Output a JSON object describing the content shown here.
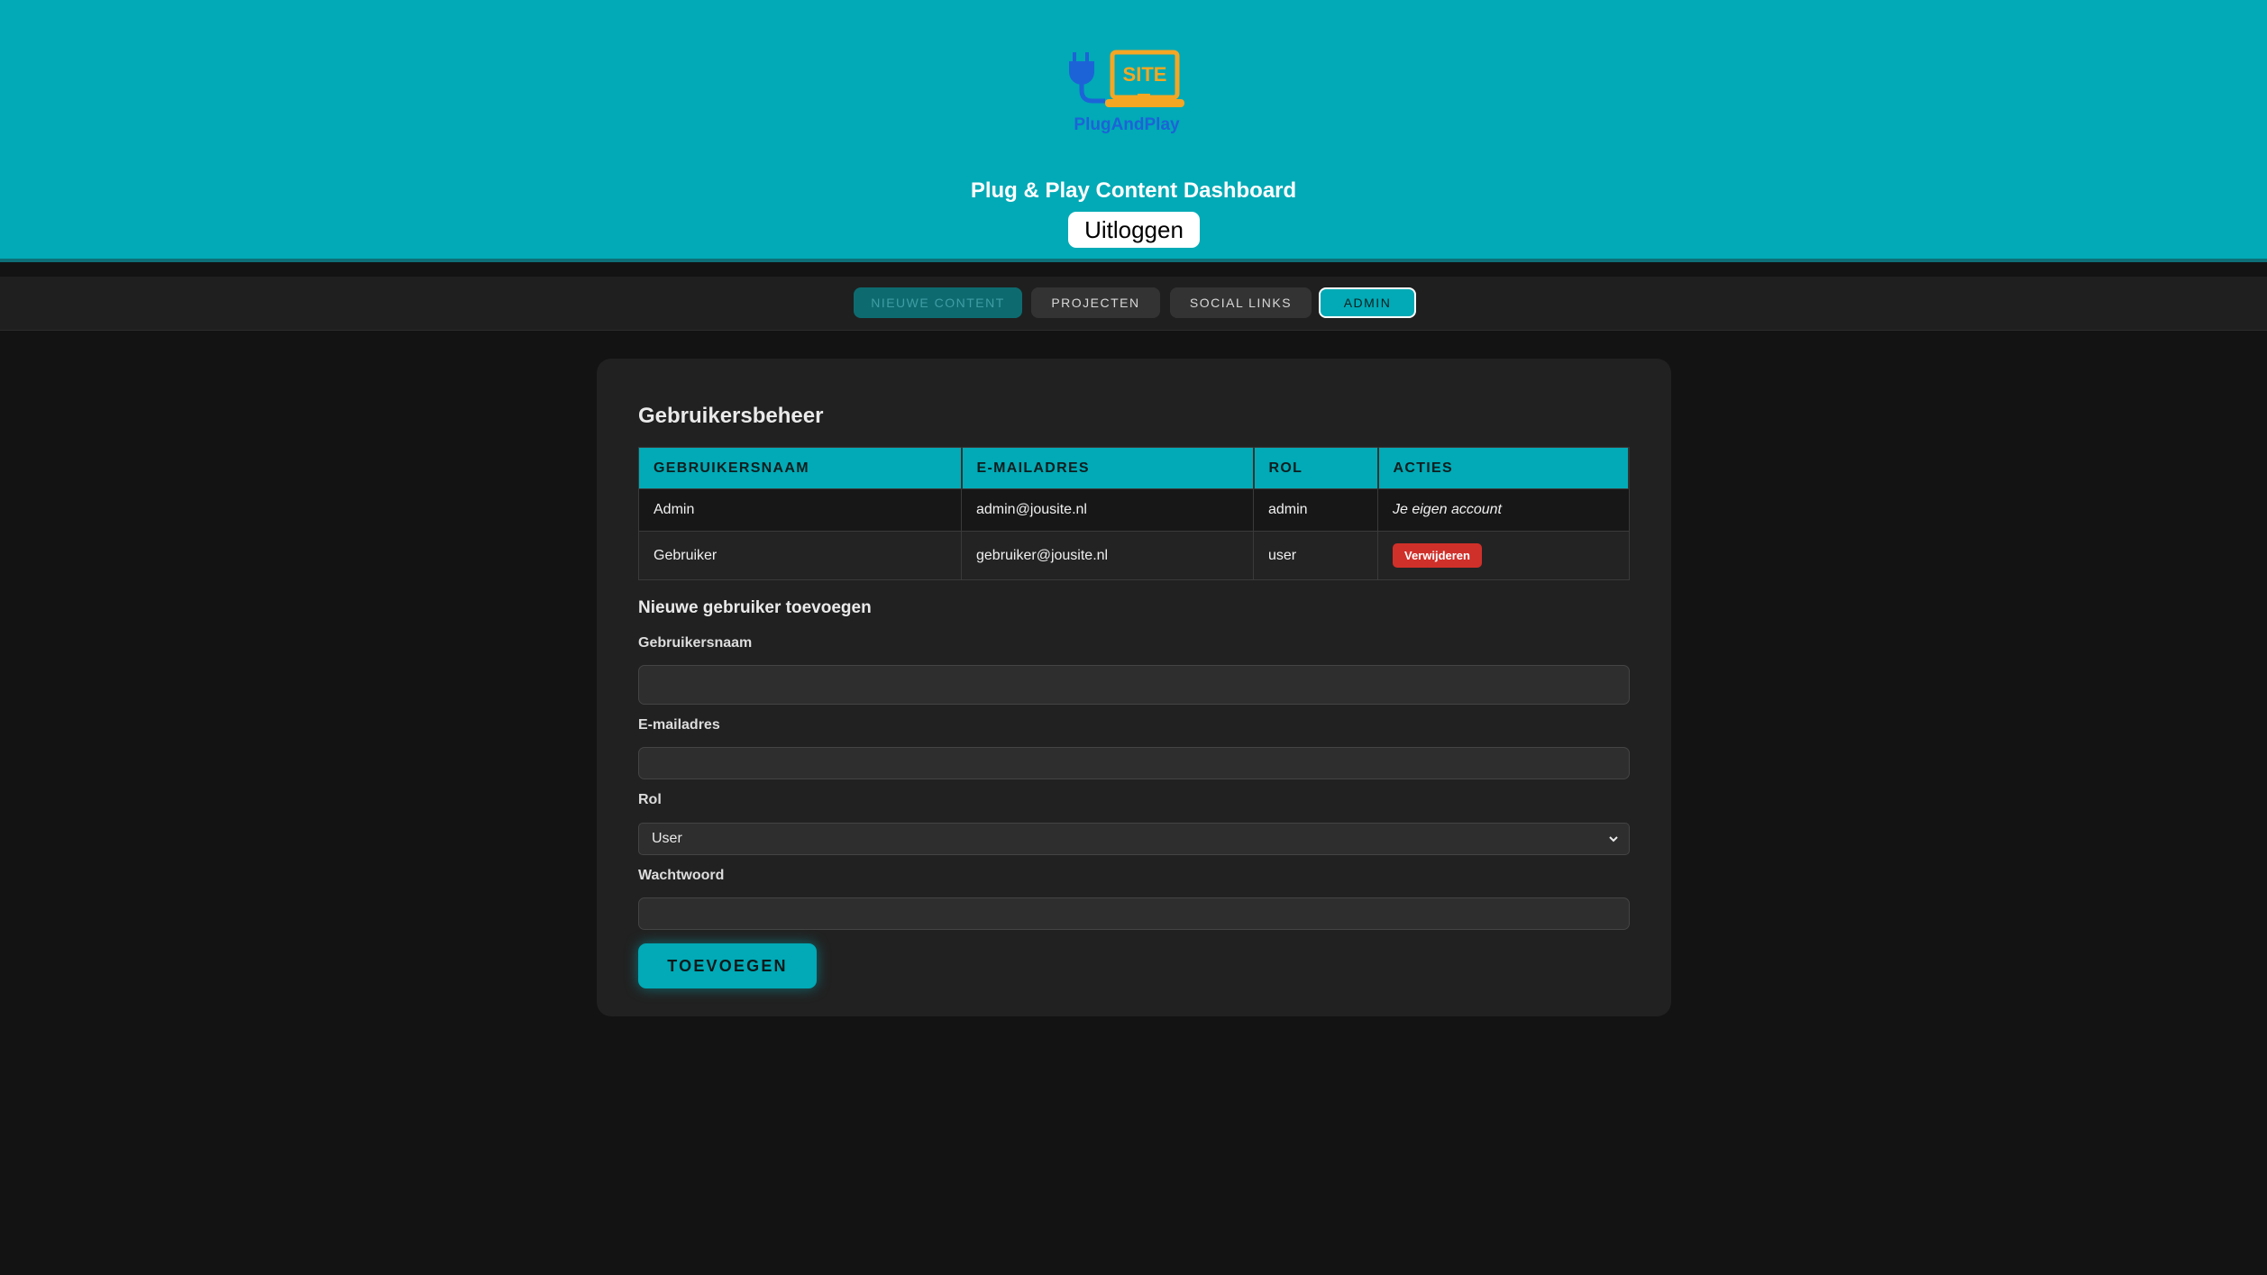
{
  "header": {
    "logo": {
      "icon": "plug-and-laptop-logo",
      "badge_text": "SITE",
      "brand_text": "PlugAndPlay"
    },
    "title": "Plug & Play Content Dashboard",
    "logout_label": "Uitloggen",
    "colors": {
      "header_bg": "#01aab6",
      "logo_blue": "#1d63d8",
      "logo_orange": "#f5a623"
    }
  },
  "nav": {
    "tabs": [
      {
        "label": "NIEUWE CONTENT",
        "state": "disabled"
      },
      {
        "label": "PROJECTEN",
        "state": "normal"
      },
      {
        "label": "SOCIAL LINKS",
        "state": "normal"
      },
      {
        "label": "ADMIN",
        "state": "active"
      }
    ]
  },
  "users": {
    "title": "Gebruikersbeheer",
    "columns": [
      "GEBRUIKERSNAAM",
      "E-MAILADRES",
      "ROL",
      "ACTIES"
    ],
    "rows": [
      {
        "username": "Admin",
        "email": "admin@jousite.nl",
        "role": "admin",
        "action": "Je eigen account"
      },
      {
        "username": "Gebruiker",
        "email": "gebruiker@jousite.nl",
        "role": "user",
        "action": "Verwijderen"
      }
    ]
  },
  "new_user": {
    "title": "Nieuwe gebruiker toevoegen",
    "username_label": "Gebruikersnaam",
    "username_value": "",
    "email_label": "E-mailadres",
    "email_value": "",
    "role_label": "Rol",
    "role_selected": "User",
    "password_label": "Wachtwoord",
    "password_value": "",
    "submit_label": "TOEVOEGEN"
  },
  "theme": {
    "accent": "#01aab6",
    "danger": "#d0302a",
    "page_bg": "#131313",
    "card_bg": "#212121"
  }
}
